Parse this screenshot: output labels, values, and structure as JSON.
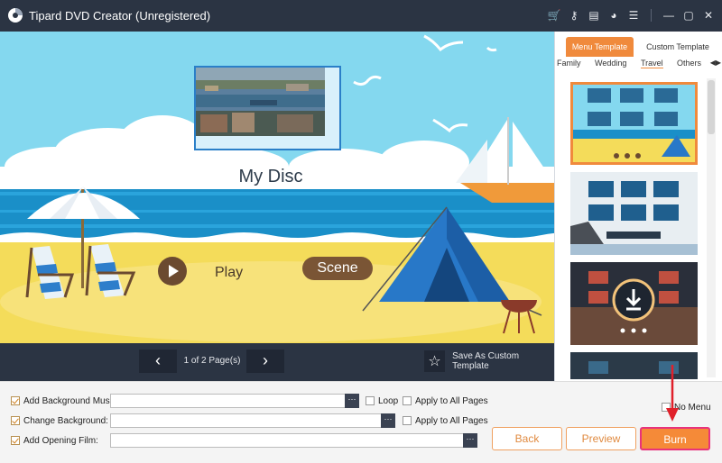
{
  "app": {
    "title": "Tipard DVD Creator (Unregistered)"
  },
  "titlebar_icons": [
    "cart-icon",
    "key-icon",
    "document-icon",
    "chat-icon",
    "menu-icon",
    "minimize-icon",
    "maximize-icon",
    "close-icon"
  ],
  "preview": {
    "disc_title": "My Disc",
    "play_label": "Play",
    "scene_label": "Scene"
  },
  "navbar": {
    "prev_symbol": "‹",
    "next_symbol": "›",
    "page_info": "1 of 2 Page(s)",
    "save_template": "Save As Custom Template"
  },
  "right_panel": {
    "tabs": [
      "Menu Template",
      "Custom Template"
    ],
    "active_tab": "Menu Template",
    "categories": [
      "Family",
      "Wedding",
      "Travel",
      "Others"
    ],
    "active_category": "Travel"
  },
  "options": {
    "bg_music_label": "Add Background Music:",
    "bg_music_value": "",
    "loop_label": "Loop",
    "apply_all_1": "Apply to All Pages",
    "change_bg_label": "Change Background:",
    "change_bg_value": "",
    "apply_all_2": "Apply to All Pages",
    "opening_film_label": "Add Opening Film:",
    "opening_film_value": "",
    "no_menu_label": "No Menu"
  },
  "buttons": {
    "back": "Back",
    "preview": "Preview",
    "burn": "Burn"
  },
  "colors": {
    "accent": "#f58a38",
    "dark": "#2b3443",
    "highlight": "#e8337a"
  }
}
